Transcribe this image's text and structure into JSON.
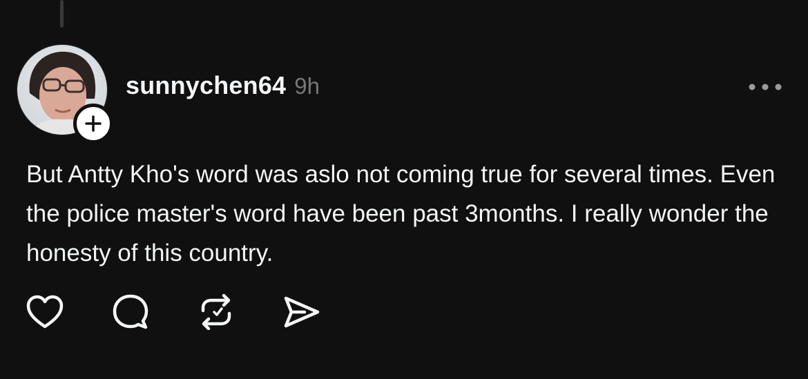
{
  "post": {
    "username": "sunnychen64",
    "timestamp": "9h",
    "text": "But Antty Kho's word was aslo not coming true for several times. Even the police master's word have been past 3months. I really wonder the honesty of this country."
  },
  "icons": {
    "follow": "plus-icon",
    "more": "more-horizontal-icon",
    "like": "heart-icon",
    "reply": "comment-bubble-icon",
    "repost": "repost-icon",
    "share": "send-icon"
  },
  "colors": {
    "background": "#101010",
    "text": "#f3f5f7",
    "muted": "#777777"
  }
}
